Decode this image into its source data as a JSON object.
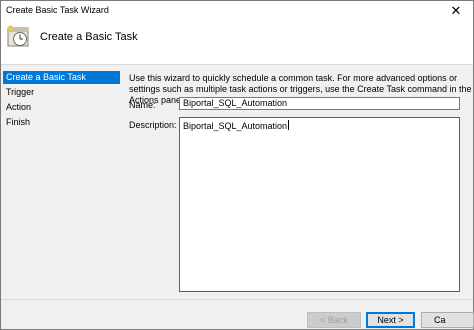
{
  "window": {
    "title": "Create Basic Task Wizard",
    "close_glyph": "✕"
  },
  "header": {
    "title": "Create a Basic Task",
    "icon": "task-scheduler-icon"
  },
  "sidebar": {
    "items": [
      {
        "label": "Create a Basic Task",
        "active": true
      },
      {
        "label": "Trigger",
        "active": false
      },
      {
        "label": "Action",
        "active": false
      },
      {
        "label": "Finish",
        "active": false
      }
    ]
  },
  "main": {
    "description": "Use this wizard to quickly schedule a common task.  For more advanced options or settings such as multiple task actions or triggers, use the Create Task command in the Actions pane.",
    "name_label": "Name:",
    "name_value": "Biportal_SQL_Automation",
    "description_label": "Description:",
    "description_value": "Biportal_SQL_Automation"
  },
  "footer": {
    "back_label": "< Back",
    "next_label": "Next >",
    "cancel_label": "Ca"
  },
  "colors": {
    "accent": "#0078d7",
    "window_bg": "#f0f0f0",
    "panel_bg": "#ffffff"
  }
}
